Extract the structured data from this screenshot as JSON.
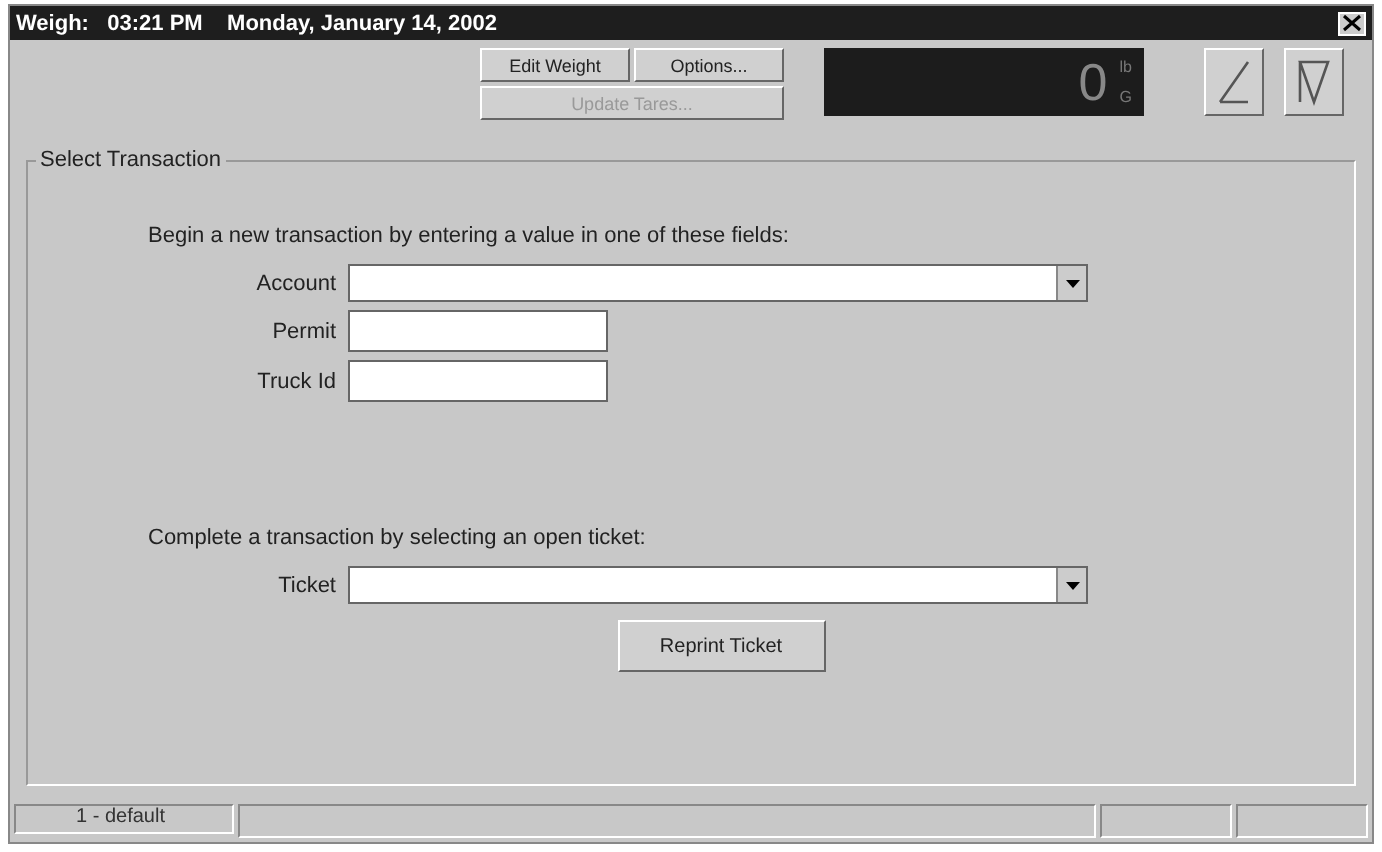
{
  "window": {
    "title": "Weigh:   03:21 PM    Monday, January 14, 2002"
  },
  "toolbar": {
    "buttons": [
      {
        "label": "Edit Weight",
        "disabled": false
      },
      {
        "label": "Options...",
        "disabled": false
      },
      {
        "label": "Update Tares...",
        "disabled": true
      }
    ]
  },
  "scale": {
    "reading": "0",
    "unit": "lb",
    "mode": "G"
  },
  "group": {
    "title": "Select Transaction",
    "new_prompt": "Begin a new transaction by entering a value in one of these fields:",
    "fields": [
      {
        "label": "Account",
        "kind": "combo"
      },
      {
        "label": "Permit",
        "kind": "text"
      },
      {
        "label": "Truck Id",
        "kind": "text"
      }
    ],
    "open_prompt": "Complete a transaction by selecting an open ticket:",
    "ticket": {
      "label": "Ticket"
    },
    "reprint_button": "Reprint Ticket"
  },
  "status_bar": [
    "1 - default"
  ]
}
